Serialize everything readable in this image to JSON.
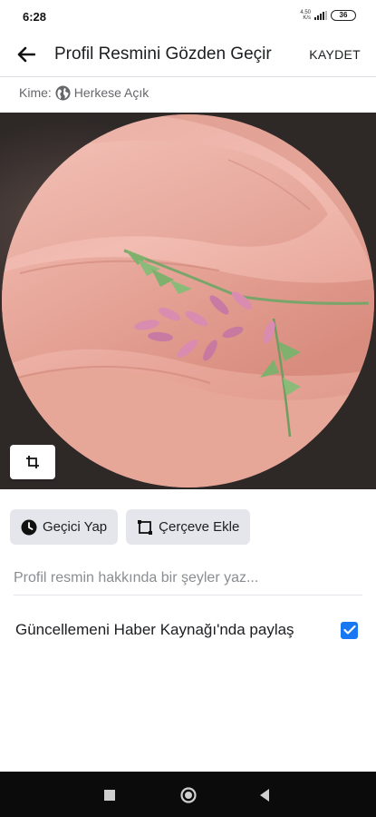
{
  "status_bar": {
    "time": "6:28",
    "net_speed_top": "4.50",
    "net_speed_bottom": "K/s",
    "battery": "36"
  },
  "header": {
    "title": "Profil Resmini Gözden Geçir",
    "save_label": "KAYDET",
    "back_icon": "arrow-left-icon"
  },
  "audience": {
    "label": "Kime:",
    "value": "Herkese Açık",
    "icon": "globe-icon"
  },
  "photo": {
    "crop_icon": "crop-icon"
  },
  "actions": [
    {
      "label": "Geçici Yap",
      "icon": "clock-icon"
    },
    {
      "label": "Çerçeve Ekle",
      "icon": "frame-icon"
    }
  ],
  "caption": {
    "placeholder": "Profil resmin hakkında bir şeyler yaz...",
    "value": ""
  },
  "share": {
    "label": "Güncellemeni Haber Kaynağı'nda paylaş",
    "checked": true
  },
  "colors": {
    "accent": "#1877f2",
    "chip_bg": "#e4e6eb",
    "nav_bg": "#0b0b0b"
  },
  "nav_bar": {
    "buttons": [
      "square-recents-icon",
      "circle-home-icon",
      "triangle-back-icon"
    ]
  }
}
